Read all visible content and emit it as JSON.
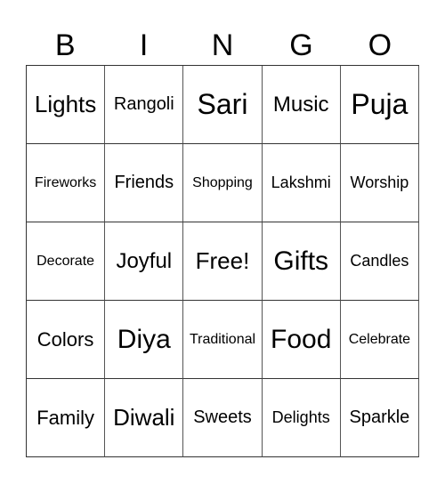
{
  "header": [
    "B",
    "I",
    "N",
    "G",
    "O"
  ],
  "rows": [
    [
      "Lights",
      "Rangoli",
      "Sari",
      "Music",
      "Puja"
    ],
    [
      "Fireworks",
      "Friends",
      "Shopping",
      "Lakshmi",
      "Worship"
    ],
    [
      "Decorate",
      "Joyful",
      "Free!",
      "Gifts",
      "Candles"
    ],
    [
      "Colors",
      "Diya",
      "Traditional",
      "Food",
      "Celebrate"
    ],
    [
      "Family",
      "Diwali",
      "Sweets",
      "Delights",
      "Sparkle"
    ]
  ]
}
